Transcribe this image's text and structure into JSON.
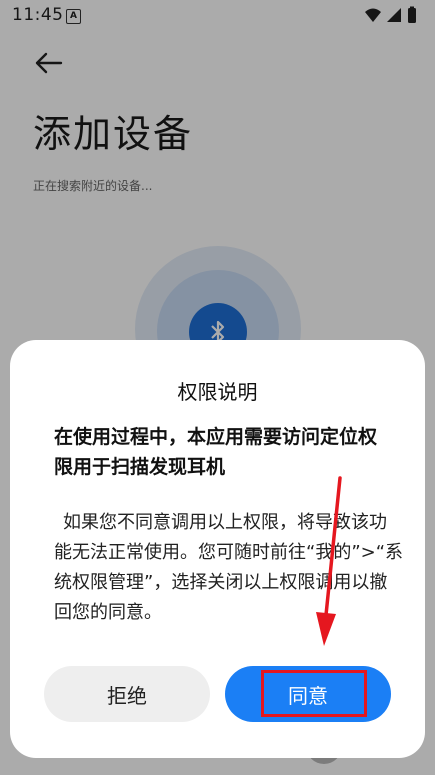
{
  "status_bar": {
    "time": "11:45",
    "notice_icon_letter": "A"
  },
  "header": {
    "title": "添加设备"
  },
  "scan": {
    "status": "正在搜索附近的设备..."
  },
  "dialog": {
    "title": "权限说明",
    "subtitle": "在使用过程中，本应用需要访问定位权限用于扫描发现耳机",
    "body": "如果您不同意调用以上权限，将导致该功能无法正常使用。您可随时前往“我的”>“系统权限管理”，选择关闭以上权限调用以撤回您的同意。",
    "reject_label": "拒绝",
    "agree_label": "同意"
  },
  "colors": {
    "accent": "#1b7ff5",
    "annotation": "#e5171f"
  }
}
